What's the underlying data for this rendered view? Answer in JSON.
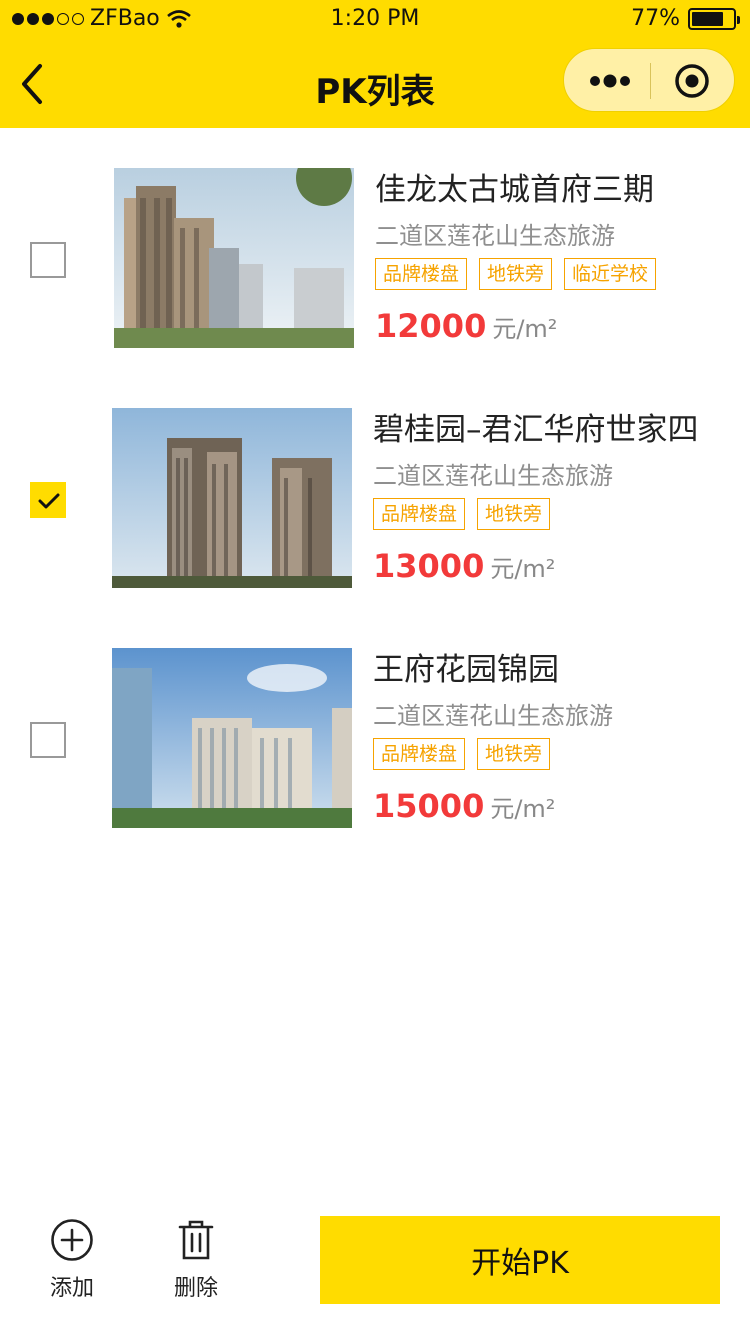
{
  "status_bar": {
    "carrier": "ZFBao",
    "time": "1:20 PM",
    "battery": "77%",
    "battery_level": 0.77
  },
  "nav": {
    "title": "PK列表"
  },
  "list": [
    {
      "name": "佳龙太古城首府三期",
      "address": "二道区莲花山生态旅游",
      "tags": [
        "品牌楼盘",
        "地铁旁",
        "临近学校"
      ],
      "price": "12000",
      "unit": "元/m²",
      "checked": false
    },
    {
      "name": "碧桂园–君汇华府世家四",
      "address": "二道区莲花山生态旅游",
      "tags": [
        "品牌楼盘",
        "地铁旁"
      ],
      "price": "13000",
      "unit": "元/m²",
      "checked": true
    },
    {
      "name": "王府花园锦园",
      "address": "二道区莲花山生态旅游",
      "tags": [
        "品牌楼盘",
        "地铁旁"
      ],
      "price": "15000",
      "unit": "元/m²",
      "checked": false
    }
  ],
  "bottom_bar": {
    "add_label": "添加",
    "delete_label": "删除",
    "start_label": "开始PK"
  },
  "colors": {
    "brand_yellow": "#FFDC00",
    "tag_orange": "#F6A300",
    "price_red": "#F23A3A"
  },
  "icons": [
    "back-arrow-icon",
    "more-dots-icon",
    "target-icon",
    "check-icon",
    "plus-circle-icon",
    "trash-icon"
  ]
}
